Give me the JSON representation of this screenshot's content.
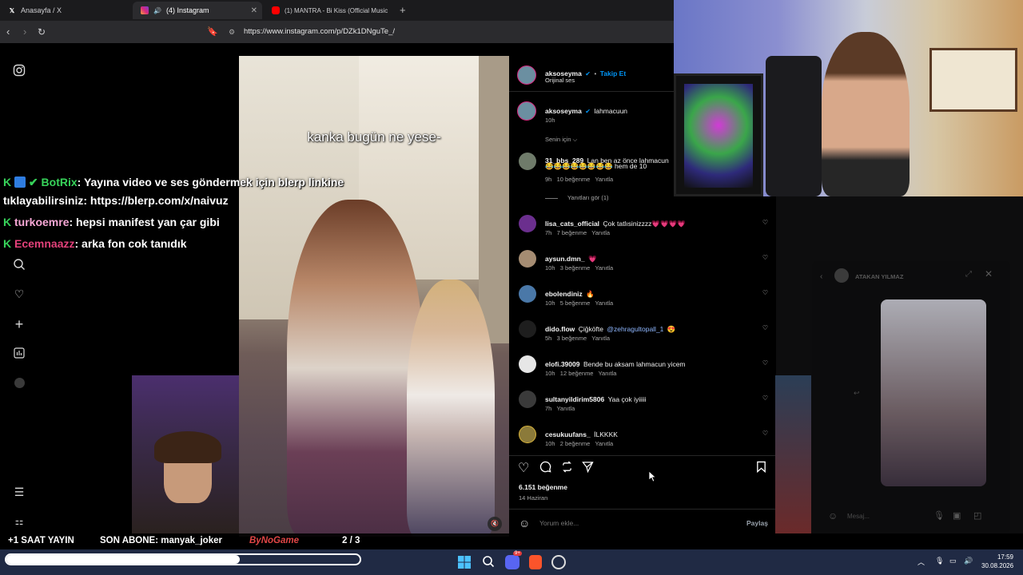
{
  "browser": {
    "tabs": [
      {
        "label": "Anasayfa / X",
        "icon": "x-logo-icon"
      },
      {
        "label": "(4) Instagram",
        "icon": "instagram-icon"
      },
      {
        "label": "(1) MANTRA - Bi Kiss (Official Music",
        "icon": "youtube-icon"
      }
    ],
    "url": "https://www.instagram.com/p/DZk1DNguTe_/"
  },
  "post": {
    "author": "aksoseyma",
    "follow_label": "Takip Et",
    "audio": "Orijinal ses",
    "caption_text": "lahmacuun",
    "caption_time": "10h",
    "video_caption": "kanka bugün ne yese-",
    "sort_label": "Senin için",
    "likes": "6.151 beğenme",
    "date": "14 Haziran",
    "comment_placeholder": "Yorum ekle...",
    "share_label": "Paylaş"
  },
  "comments": [
    {
      "user": "31_bbs_289",
      "text": "Lan ben az önce lahmacun",
      "text2": "😂😂😂😂😂😂😂😂 hem de 10",
      "time": "9h",
      "likes": "10 beğenme",
      "reply": "Yanıtla",
      "replies_label": "Yanıtları gör (1)"
    },
    {
      "user": "lisa_cats_official",
      "text": "Çok tatlısinizzzz💗💗💗💗",
      "time": "7h",
      "likes": "7 beğenme",
      "reply": "Yanıtla"
    },
    {
      "user": "aysun.dmn_",
      "text": "💗",
      "time": "10h",
      "likes": "3 beğenme",
      "reply": "Yanıtla"
    },
    {
      "user": "ebolendiniz",
      "text": "🔥",
      "time": "10h",
      "likes": "5 beğenme",
      "reply": "Yanıtla"
    },
    {
      "user": "dido.flow",
      "text": "Çiğköfte",
      "mention": "@zehragultopall_1",
      "emoji": "😍",
      "time": "5h",
      "likes": "3 beğenme",
      "reply": "Yanıtla"
    },
    {
      "user": "elofi.39009",
      "text": "Bende bu aksam lahmacun yicem",
      "time": "10h",
      "likes": "12 beğenme",
      "reply": "Yanıtla"
    },
    {
      "user": "sultanyildirim5806",
      "text": "Yaa çok iyiiiii",
      "time": "7h",
      "likes": "",
      "reply": "Yanıtla"
    },
    {
      "user": "cesukuufans_",
      "text": "İLKKKK",
      "time": "10h",
      "likes": "2 beğenme",
      "reply": "Yanıtla"
    }
  ],
  "chat": [
    {
      "user": "BotRix",
      "text": ": Yayına video ve ses göndermek için blerp linkine",
      "user_color": "#37d35a"
    },
    {
      "user": "",
      "text": "tıklayabilirsiniz: https://blerp.com/x/naivuz",
      "user_color": "#ffffff"
    },
    {
      "user": "turkoemre",
      "text": ": hepsi manifest yan çar gibi",
      "user_color": "#f7a8d6"
    },
    {
      "user": "Ecemnaazz",
      "text": ": arka fon cok tanıdık",
      "user_color": "#e3417a"
    }
  ],
  "dm": {
    "name": "ATAKAN YILMAZ",
    "placeholder": "Mesaj..."
  },
  "stream_bar": {
    "left": "+1 SAAT YAYIN",
    "middle": "SON ABONE: manyak_joker",
    "brand": "ByNoGame",
    "page": "2 / 3",
    "progress": 0.66
  },
  "taskbar": {
    "time": "17:59",
    "date": "30.08.2026",
    "discord_badge": "9+"
  },
  "colors": {
    "accent_blue": "#0095f6",
    "chat_green": "#37d35a",
    "taskbar": "#202a44"
  }
}
